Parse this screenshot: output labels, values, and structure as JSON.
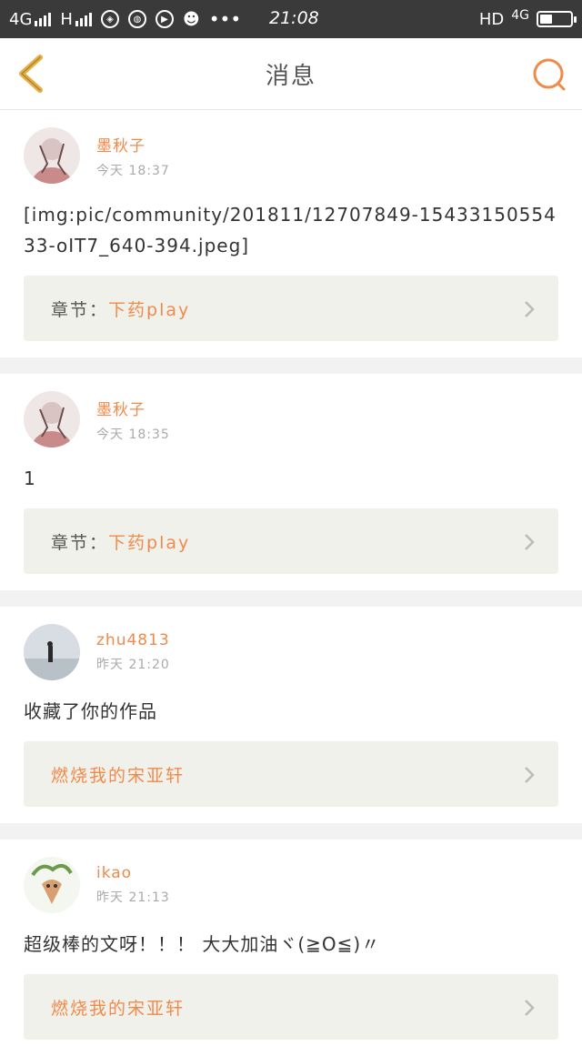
{
  "status_bar": {
    "network_1": "4G",
    "network_2": "H",
    "time": "21:08",
    "hd": "HD",
    "network_3": "4G",
    "battery_level": 0.4
  },
  "header": {
    "title": "消息"
  },
  "messages": [
    {
      "user": "墨秋子",
      "time": "今天 18:37",
      "text": "[img:pic/community/201811/12707849-1543315055433-oIT7_640-394.jpeg]",
      "ref_label": "章节：",
      "ref_title": "下药play"
    },
    {
      "user": "墨秋子",
      "time": "今天 18:35",
      "text": "1",
      "ref_label": "章节：",
      "ref_title": "下药play"
    },
    {
      "user": "zhu4813",
      "time": "昨天 21:20",
      "text": "收藏了你的作品",
      "ref_label": "",
      "ref_title": "燃烧我的宋亚轩"
    },
    {
      "user": "ikao",
      "time": "昨天 21:13",
      "text": "超级棒的文呀！！！ 大大加油ヾ(≧O≦)〃",
      "ref_label": "",
      "ref_title": "燃烧我的宋亚轩"
    }
  ],
  "colors": {
    "accent": "#f08a4b",
    "back_arrow": "#e8b040"
  }
}
